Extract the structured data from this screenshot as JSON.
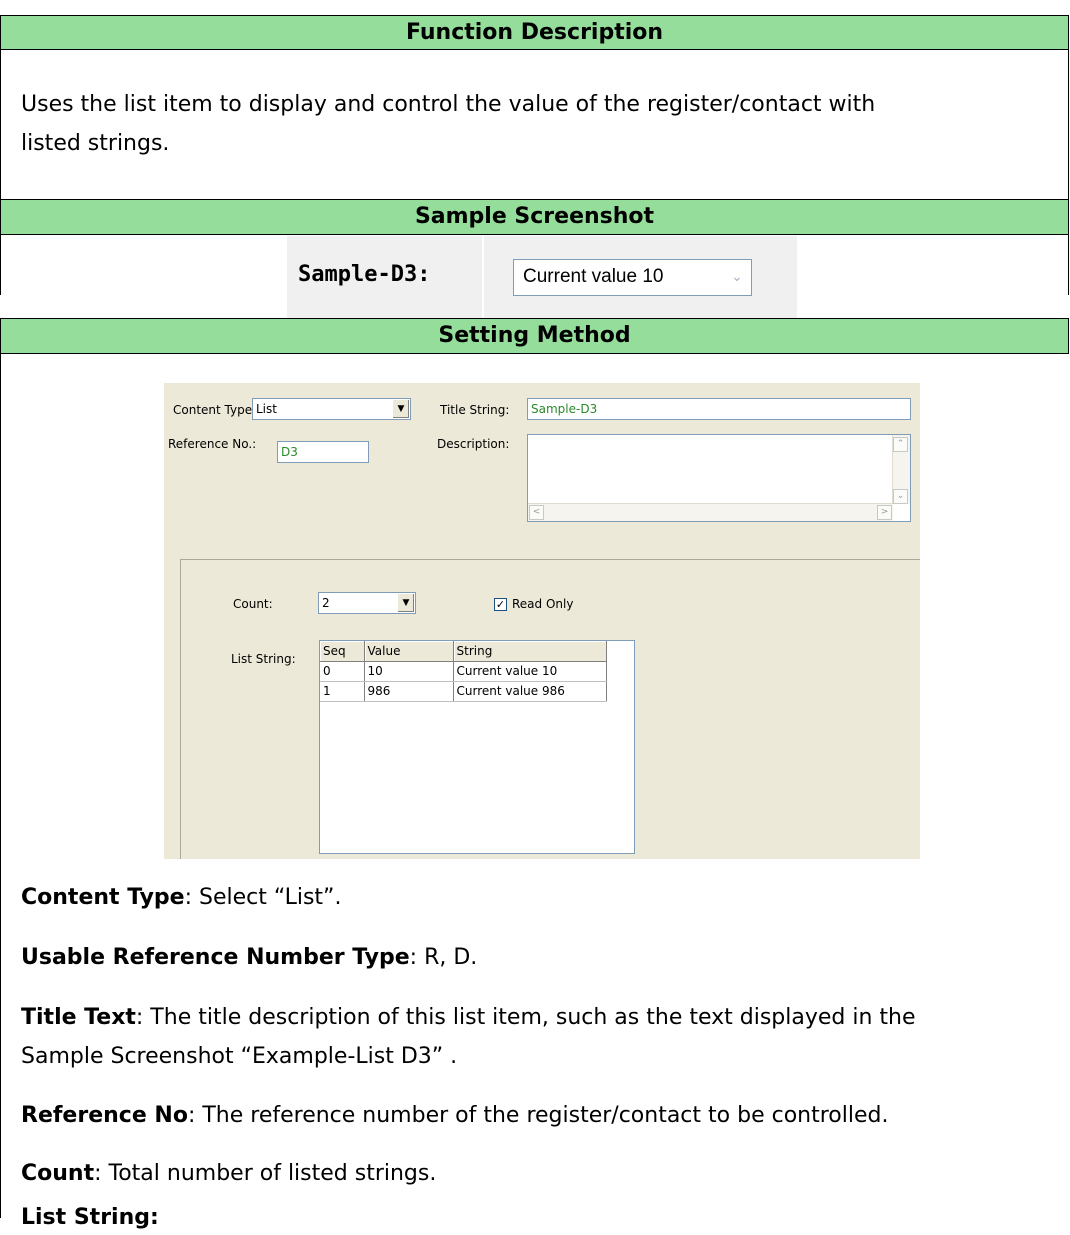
{
  "sections": {
    "function_description": {
      "title": "Function Description",
      "text_line1": "Uses the list item to display and control the value of the register/contact with",
      "text_line2": "listed strings."
    },
    "sample_screenshot": {
      "title": "Sample Screenshot",
      "label": "Sample-D3:",
      "selected_value": "Current value 10"
    },
    "setting_method": {
      "title": "Setting Method"
    }
  },
  "dialog": {
    "content_type_label": "Content Type:",
    "content_type_value": "List",
    "reference_no_label": "Reference No.:",
    "reference_no_value": "D3",
    "title_string_label": "Title String:",
    "title_string_value": "Sample-D3",
    "description_label": "Description:",
    "description_value": "",
    "count_label": "Count:",
    "count_value": "2",
    "read_only_label": "Read Only",
    "read_only_checked": true,
    "list_string_label": "List String:",
    "grid": {
      "headers": [
        "Seq",
        "Value",
        "String"
      ],
      "rows": [
        [
          "0",
          "10",
          "Current value 10"
        ],
        [
          "1",
          "986",
          "Current value 986"
        ]
      ]
    }
  },
  "descriptions": {
    "content_type_term": "Content Type",
    "content_type_text": ": Select “List”.",
    "usable_ref_term": "Usable Reference Number Type",
    "usable_ref_text": ": R, D.",
    "title_text_term": "Title Text",
    "title_text_text_line1": ": The title description of this list item, such as the text displayed in the",
    "title_text_text_line2": "Sample Screenshot “Example-List D3” .",
    "reference_no_term": "Reference No",
    "reference_no_text": ": The reference number of the register/contact to be controlled.",
    "count_term": "Count",
    "count_text": ": Total number of listed strings.",
    "list_string_term": "List String:"
  }
}
